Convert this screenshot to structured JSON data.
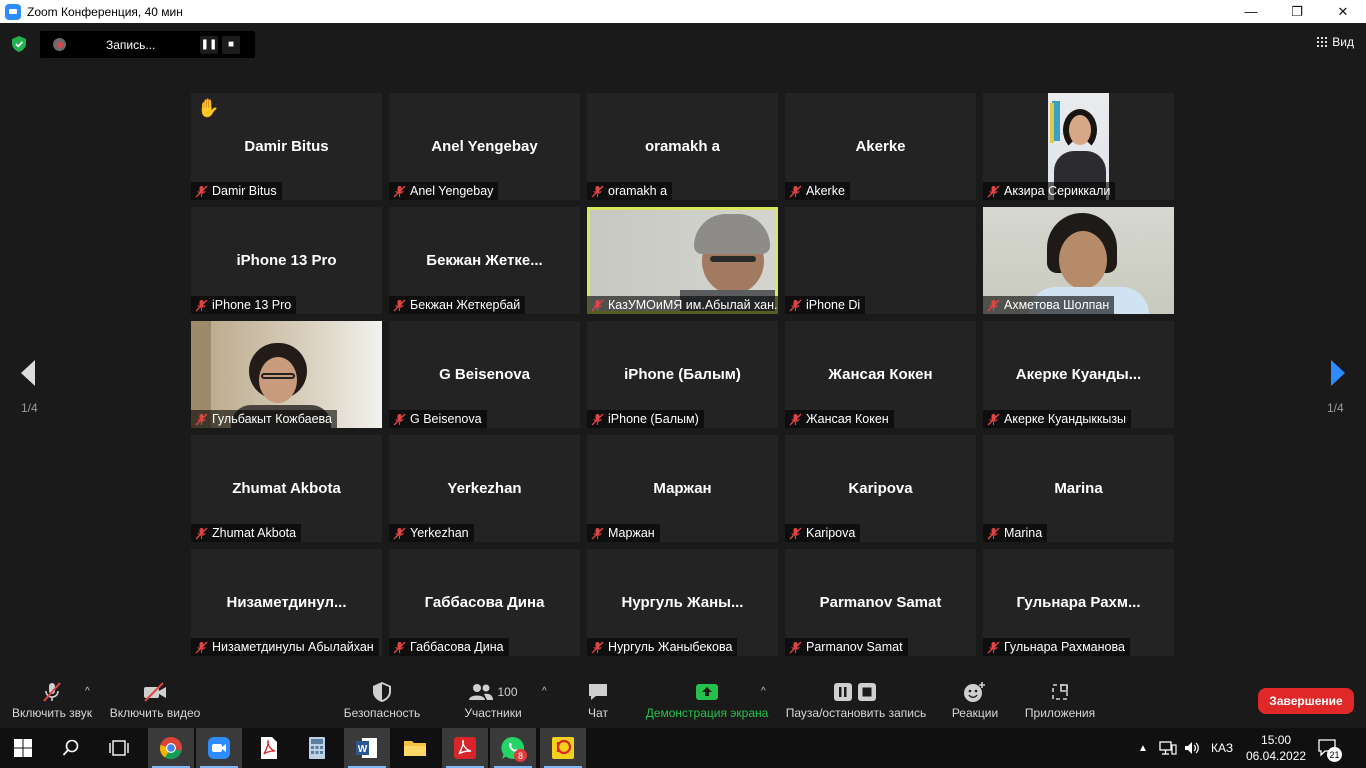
{
  "window": {
    "title": "Zoom Конференция, 40 мин",
    "controls": [
      "—",
      "❐",
      "✕"
    ]
  },
  "recording": {
    "label": "Запись..."
  },
  "view_button": {
    "label": "Вид"
  },
  "pagination": {
    "left": "1/4",
    "right": "1/4"
  },
  "tiles": [
    {
      "name": "Damir Bitus",
      "tag": "Damir Bitus",
      "hand": "✋"
    },
    {
      "name": "Anel Yengebay",
      "tag": "Anel Yengebay"
    },
    {
      "name": "oramakh a",
      "tag": "oramakh a"
    },
    {
      "name": "Akerke",
      "tag": "Akerke"
    },
    {
      "name": "",
      "tag": "Акзира Сериккали"
    },
    {
      "name": "iPhone 13 Pro",
      "tag": "iPhone 13 Pro"
    },
    {
      "name": "Бекжан  Жетке...",
      "tag": "Бекжан Жеткербай"
    },
    {
      "name": "",
      "tag": "КазУМОиМЯ им.Абылай хан..."
    },
    {
      "name": "",
      "tag": "iPhone Di"
    },
    {
      "name": "",
      "tag": "Ахметова Шолпан"
    },
    {
      "name": "",
      "tag": "Гульбакыт Кожбаева"
    },
    {
      "name": "G Beisenova",
      "tag": "G Beisenova"
    },
    {
      "name": "iPhone (Балым)",
      "tag": "iPhone (Балым)"
    },
    {
      "name": "Жансая Кокен",
      "tag": "Жансая Кокен"
    },
    {
      "name": "Акерке  Куанды...",
      "tag": "Акерке Куандыккызы"
    },
    {
      "name": "Zhumat Akbota",
      "tag": "Zhumat Akbota"
    },
    {
      "name": "Yerkezhan",
      "tag": "Yerkezhan"
    },
    {
      "name": "Маржан",
      "tag": "Маржан"
    },
    {
      "name": "Karipova",
      "tag": "Karipova"
    },
    {
      "name": "Marina",
      "tag": "Marina"
    },
    {
      "name": "Низаметдинул...",
      "tag": "Низаметдинулы Абылайхан"
    },
    {
      "name": "Габбасова Дина",
      "tag": "Габбасова Дина"
    },
    {
      "name": "Нургуль  Жаны...",
      "tag": "Нургуль Жаныбекова"
    },
    {
      "name": "Parmanov Samat",
      "tag": "Parmanov Samat"
    },
    {
      "name": "Гульнара  Рахм...",
      "tag": "Гульнара Рахманова"
    }
  ],
  "toolbar": {
    "unmute": "Включить звук",
    "start_video": "Включить видео",
    "security": "Безопасность",
    "participants": "Участники",
    "participants_count": "100",
    "chat": "Чат",
    "share": "Демонстрация экрана",
    "pause_record": "Пауза/остановить запись",
    "reactions": "Реакции",
    "apps": "Приложения",
    "end": "Завершение"
  },
  "taskbar": {
    "whatsapp_badge": "8",
    "lang": "КАЗ",
    "time": "15:00",
    "date": "06.04.2022",
    "notifications": "21"
  },
  "colors": {
    "share_green": "#24c24a",
    "end_red": "#e02828",
    "active_speaker": "#d8e85a",
    "muted_red": "#e04545"
  }
}
